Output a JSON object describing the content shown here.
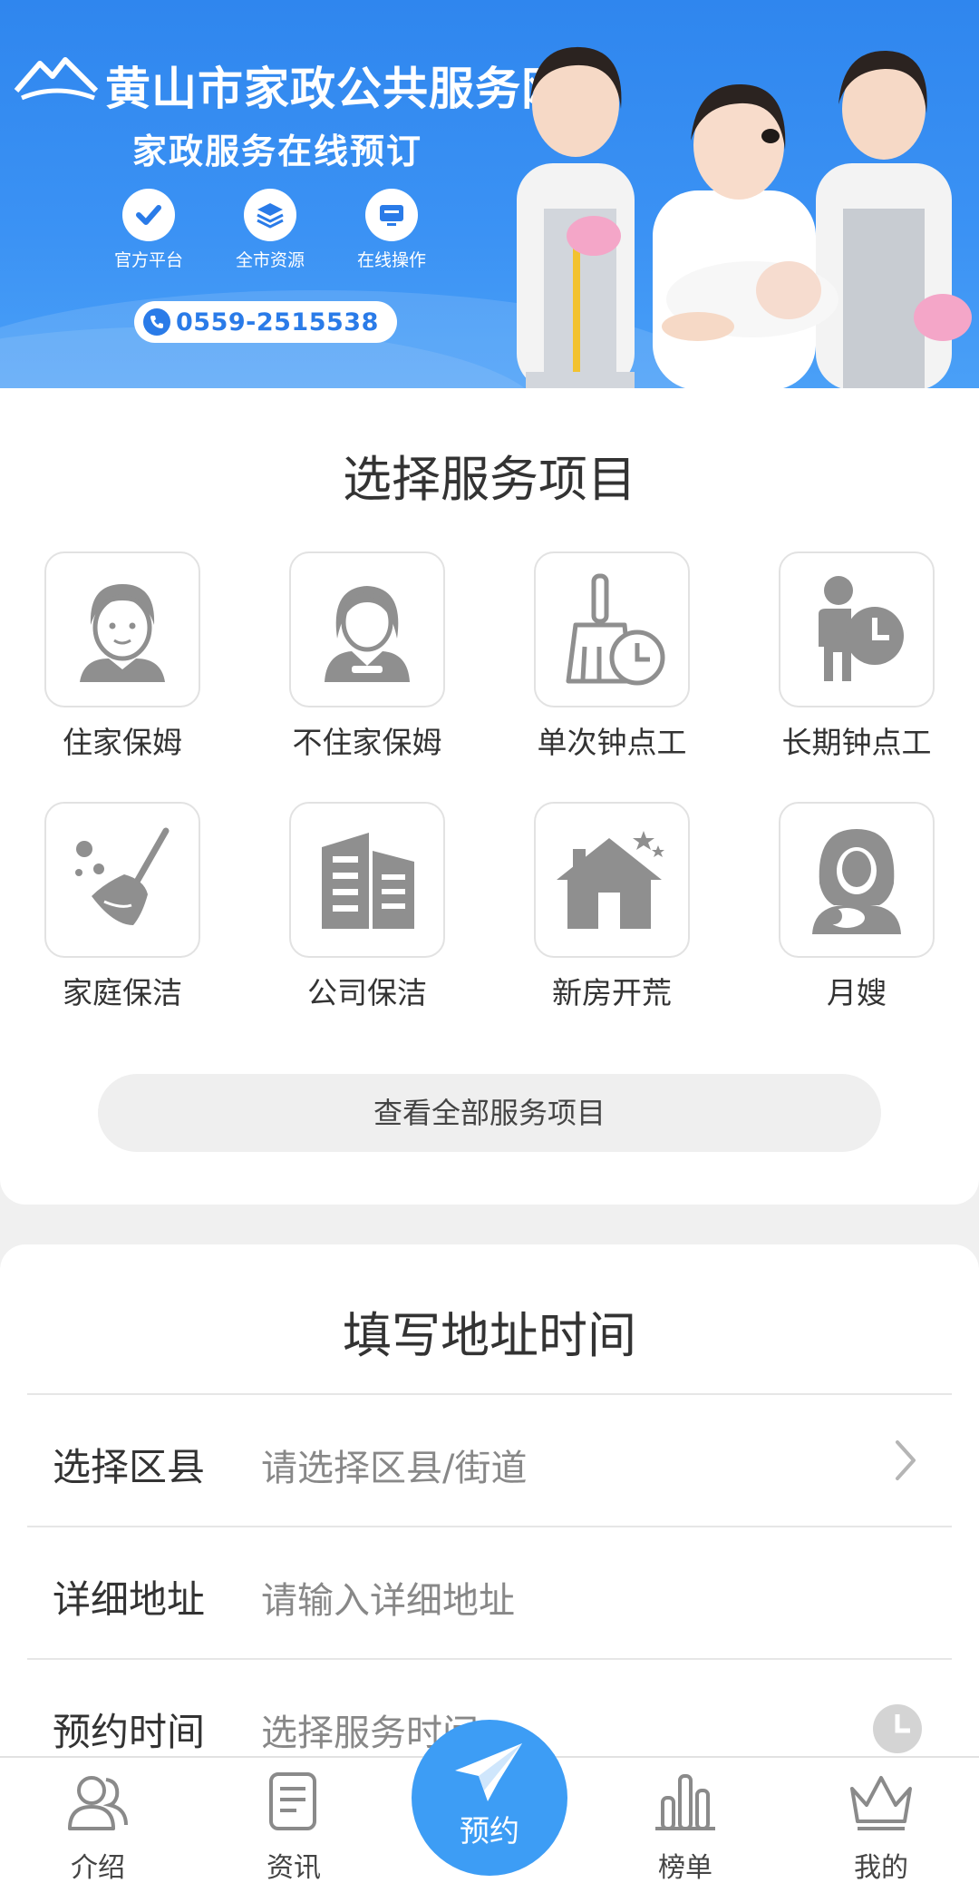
{
  "banner": {
    "site_title": "黄山市家政公共服务网",
    "subtitle": "家政服务在线预订",
    "features": [
      {
        "label": "官方平台",
        "icon": "check-badge-icon"
      },
      {
        "label": "全市资源",
        "icon": "layers-badge-icon"
      },
      {
        "label": "在线操作",
        "icon": "monitor-badge-icon"
      }
    ],
    "phone": "0559-2515538"
  },
  "services": {
    "title": "选择服务项目",
    "items": [
      {
        "label": "住家保姆",
        "icon": "nanny-icon"
      },
      {
        "label": "不住家保姆",
        "icon": "day-nanny-icon"
      },
      {
        "label": "单次钟点工",
        "icon": "broom-clock-icon"
      },
      {
        "label": "长期钟点工",
        "icon": "worker-clock-icon"
      },
      {
        "label": "家庭保洁",
        "icon": "sweep-icon"
      },
      {
        "label": "公司保洁",
        "icon": "office-building-icon"
      },
      {
        "label": "新房开荒",
        "icon": "new-house-icon"
      },
      {
        "label": "月嫂",
        "icon": "mother-baby-icon"
      }
    ],
    "view_all": "查看全部服务项目"
  },
  "address": {
    "title": "填写地址时间",
    "district": {
      "label": "选择区县",
      "placeholder": "请选择区县/街道"
    },
    "detail": {
      "label": "详细地址",
      "placeholder": "请输入详细地址"
    },
    "time": {
      "label": "预约时间",
      "placeholder": "选择服务时间"
    }
  },
  "tabbar": {
    "items": [
      {
        "label": "介绍",
        "icon": "users-icon"
      },
      {
        "label": "资讯",
        "icon": "document-icon"
      },
      {
        "label": "预约",
        "icon": "paper-plane-icon"
      },
      {
        "label": "榜单",
        "icon": "bar-chart-icon"
      },
      {
        "label": "我的",
        "icon": "crown-icon"
      }
    ]
  },
  "colors": {
    "brand": "#3d9df5",
    "banner": "#2f86ee",
    "icon_gray": "#8f8f8f"
  }
}
